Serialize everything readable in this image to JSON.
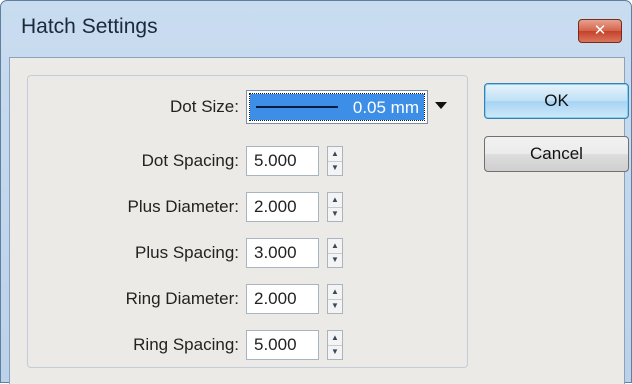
{
  "window": {
    "title": "Hatch Settings",
    "close_glyph": "✕"
  },
  "form": {
    "dot_size": {
      "label": "Dot Size:",
      "value": "0.05 mm"
    },
    "fields": [
      {
        "label": "Dot Spacing:",
        "value": "5.000"
      },
      {
        "label": "Plus Diameter:",
        "value": "2.000"
      },
      {
        "label": "Plus Spacing:",
        "value": "3.000"
      },
      {
        "label": "Ring Diameter:",
        "value": "2.000"
      },
      {
        "label": "Ring Spacing:",
        "value": "5.000"
      }
    ]
  },
  "buttons": {
    "ok_label": "OK",
    "cancel_label": "Cancel"
  },
  "icons": {
    "spin_up": "▲",
    "spin_down": "▼"
  },
  "colors": {
    "selection": "#3d8ee6",
    "close_button": "#c6412a",
    "default_button": "#a6d3f3"
  }
}
